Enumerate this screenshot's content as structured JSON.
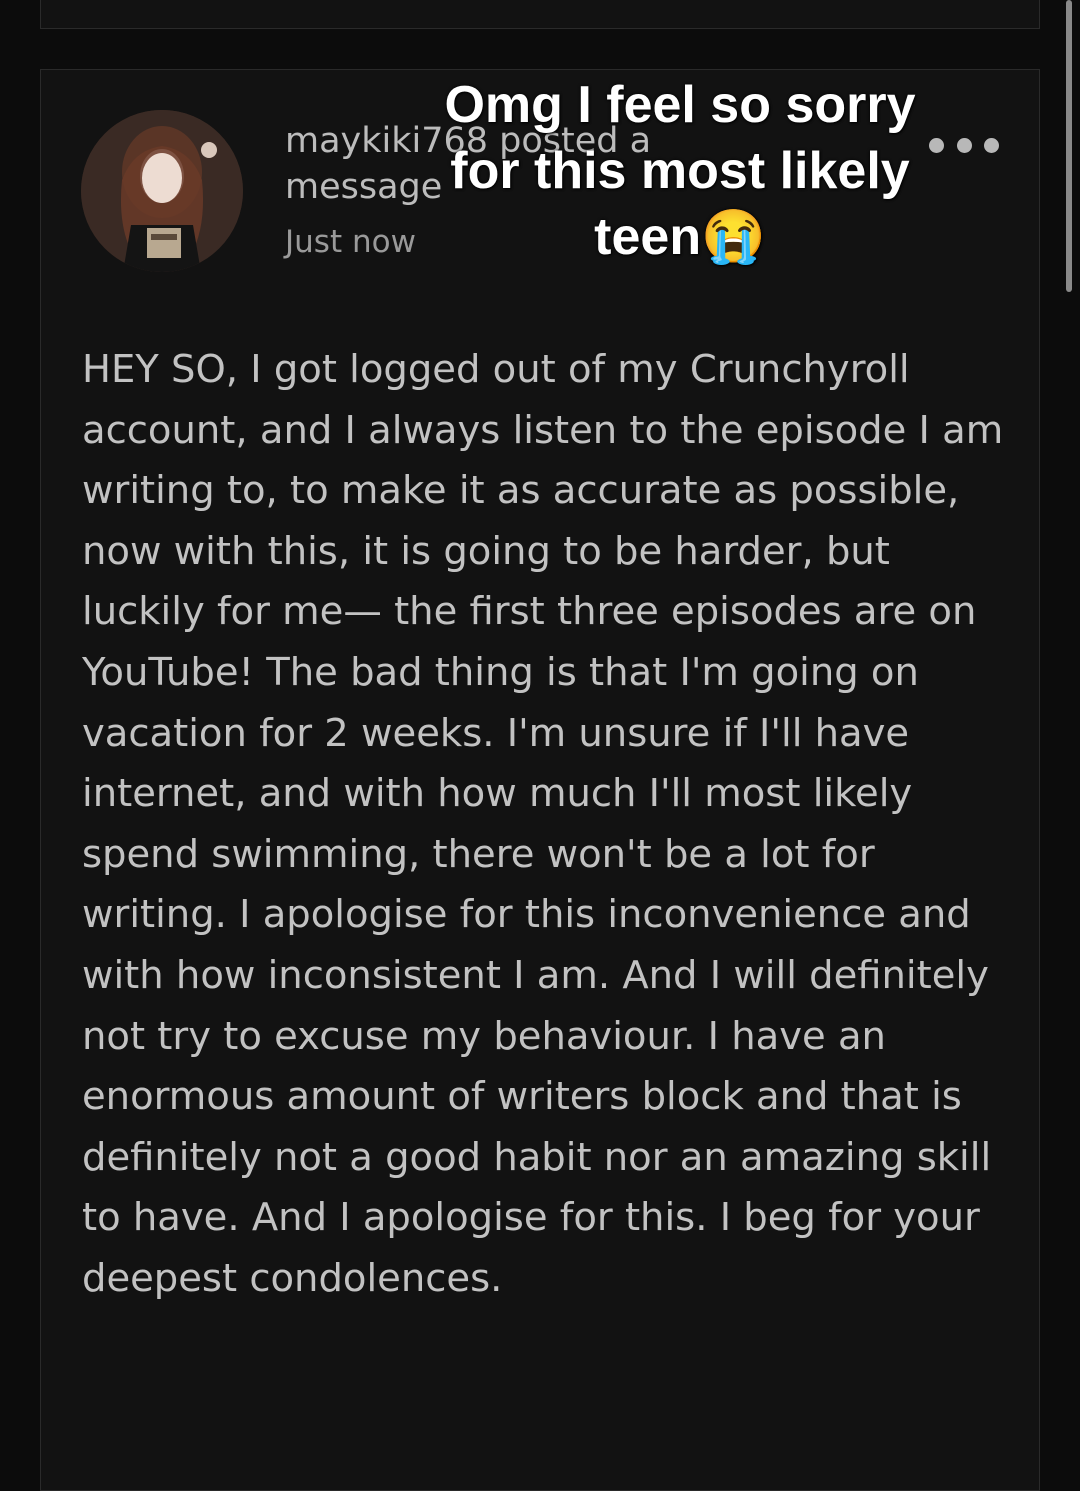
{
  "post": {
    "author_line": "maykiki768 posted a message",
    "timestamp": "Just now",
    "body": "HEY SO, I got logged out of my Crunchyroll account, and I always listen to the episode I am writing to, to make it as accurate as possible, now with this, it is going to be harder, but luckily for me— the first three episodes are on YouTube! The bad thing is that I'm going on vacation for 2 weeks. I'm unsure if I'll have internet, and with how much I'll most likely spend swimming, there won't be a lot for writing. I apologise for this inconvenience and with how inconsistent I am. And I will definitely not try to excuse my behaviour. I have an enormous amount of writers block and that is definitely not a good habit nor an amazing skill to have. And I apologise for this. I beg for your deepest condolences.",
    "more_icon": "more-horizontal-icon"
  },
  "overlay": {
    "caption": "Omg I feel so sorry for this most likely teen😭"
  },
  "colors": {
    "background": "#0c0c0c",
    "card": "#121212",
    "card_border": "#2a2a2a",
    "text": "#c2c2c2",
    "muted": "#9a9a9a"
  }
}
